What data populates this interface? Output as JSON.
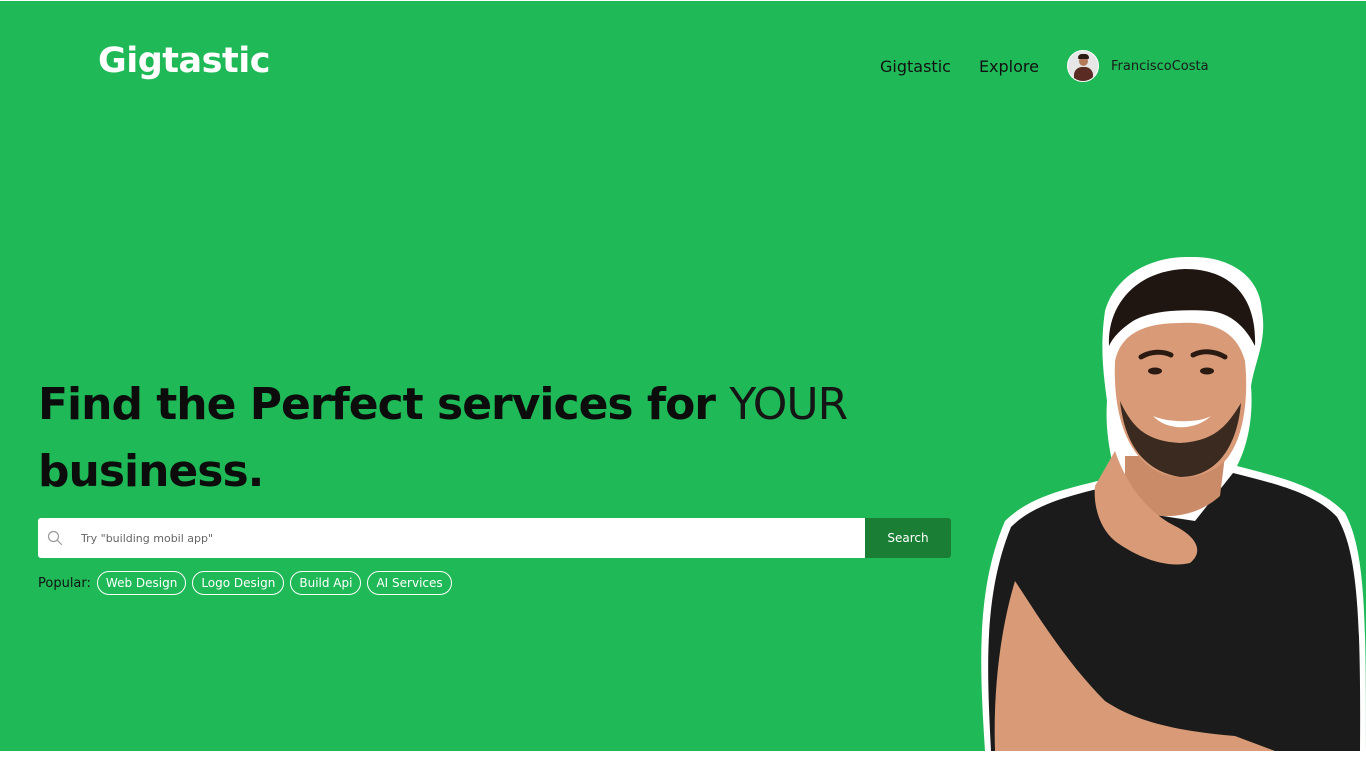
{
  "header": {
    "logo": "Gigtastic",
    "nav": {
      "link_1": "Gigtastic",
      "link_2": "Explore",
      "user_name": "FranciscoCosta"
    }
  },
  "hero": {
    "headline_bold": "Find the Perfect services for",
    "headline_light": "YOUR",
    "headline_line2": "business.",
    "search": {
      "placeholder": "Try \"building mobil app\"",
      "button_label": "Search"
    },
    "popular": {
      "label": "Popular:",
      "tags": [
        "Web Design",
        "Logo Design",
        "Build Api",
        "AI Services"
      ]
    }
  },
  "colors": {
    "hero_background": "#1fba57",
    "search_button": "#1a7f35"
  }
}
